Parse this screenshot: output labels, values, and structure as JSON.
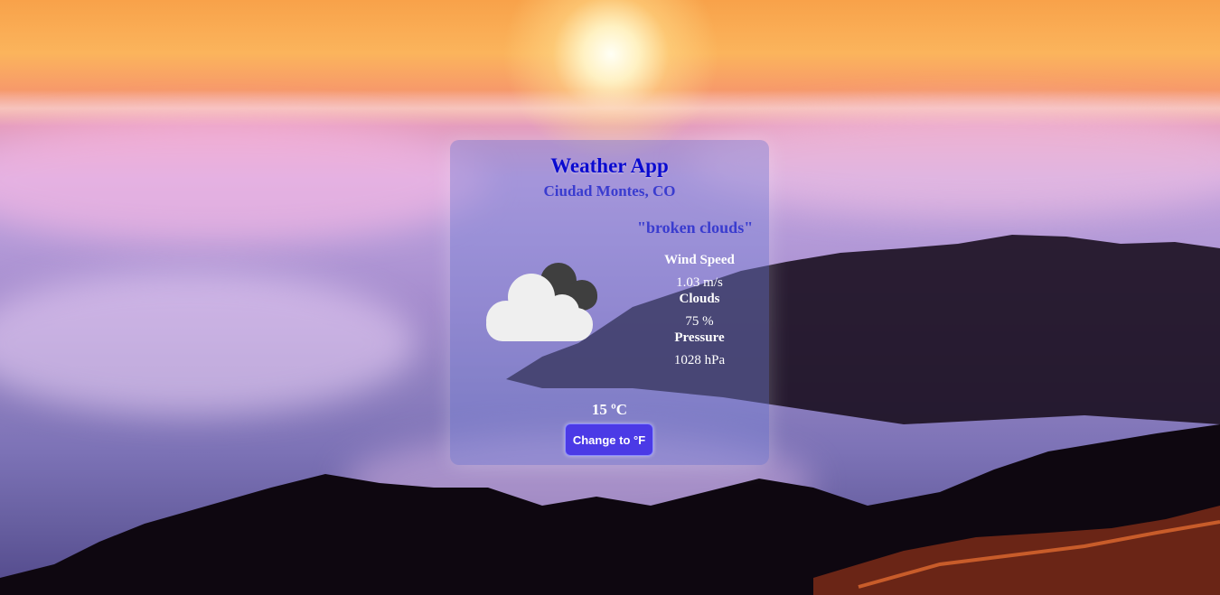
{
  "app": {
    "title": "Weather App",
    "location": "Ciudad Montes, CO",
    "description": "\"broken clouds\""
  },
  "weather": {
    "icon": "broken-clouds-icon",
    "stats": [
      {
        "label": "Wind Speed",
        "value": "1.03 m/s"
      },
      {
        "label": "Clouds",
        "value": "75 %"
      },
      {
        "label": "Pressure",
        "value": "1028 hPa"
      }
    ],
    "temperature": "15 ºC"
  },
  "controls": {
    "toggle_unit_label": "Change to °F"
  },
  "colors": {
    "title": "#0a0ad0",
    "subtitle": "#3a3ccf",
    "button": "#4b3ae6"
  }
}
